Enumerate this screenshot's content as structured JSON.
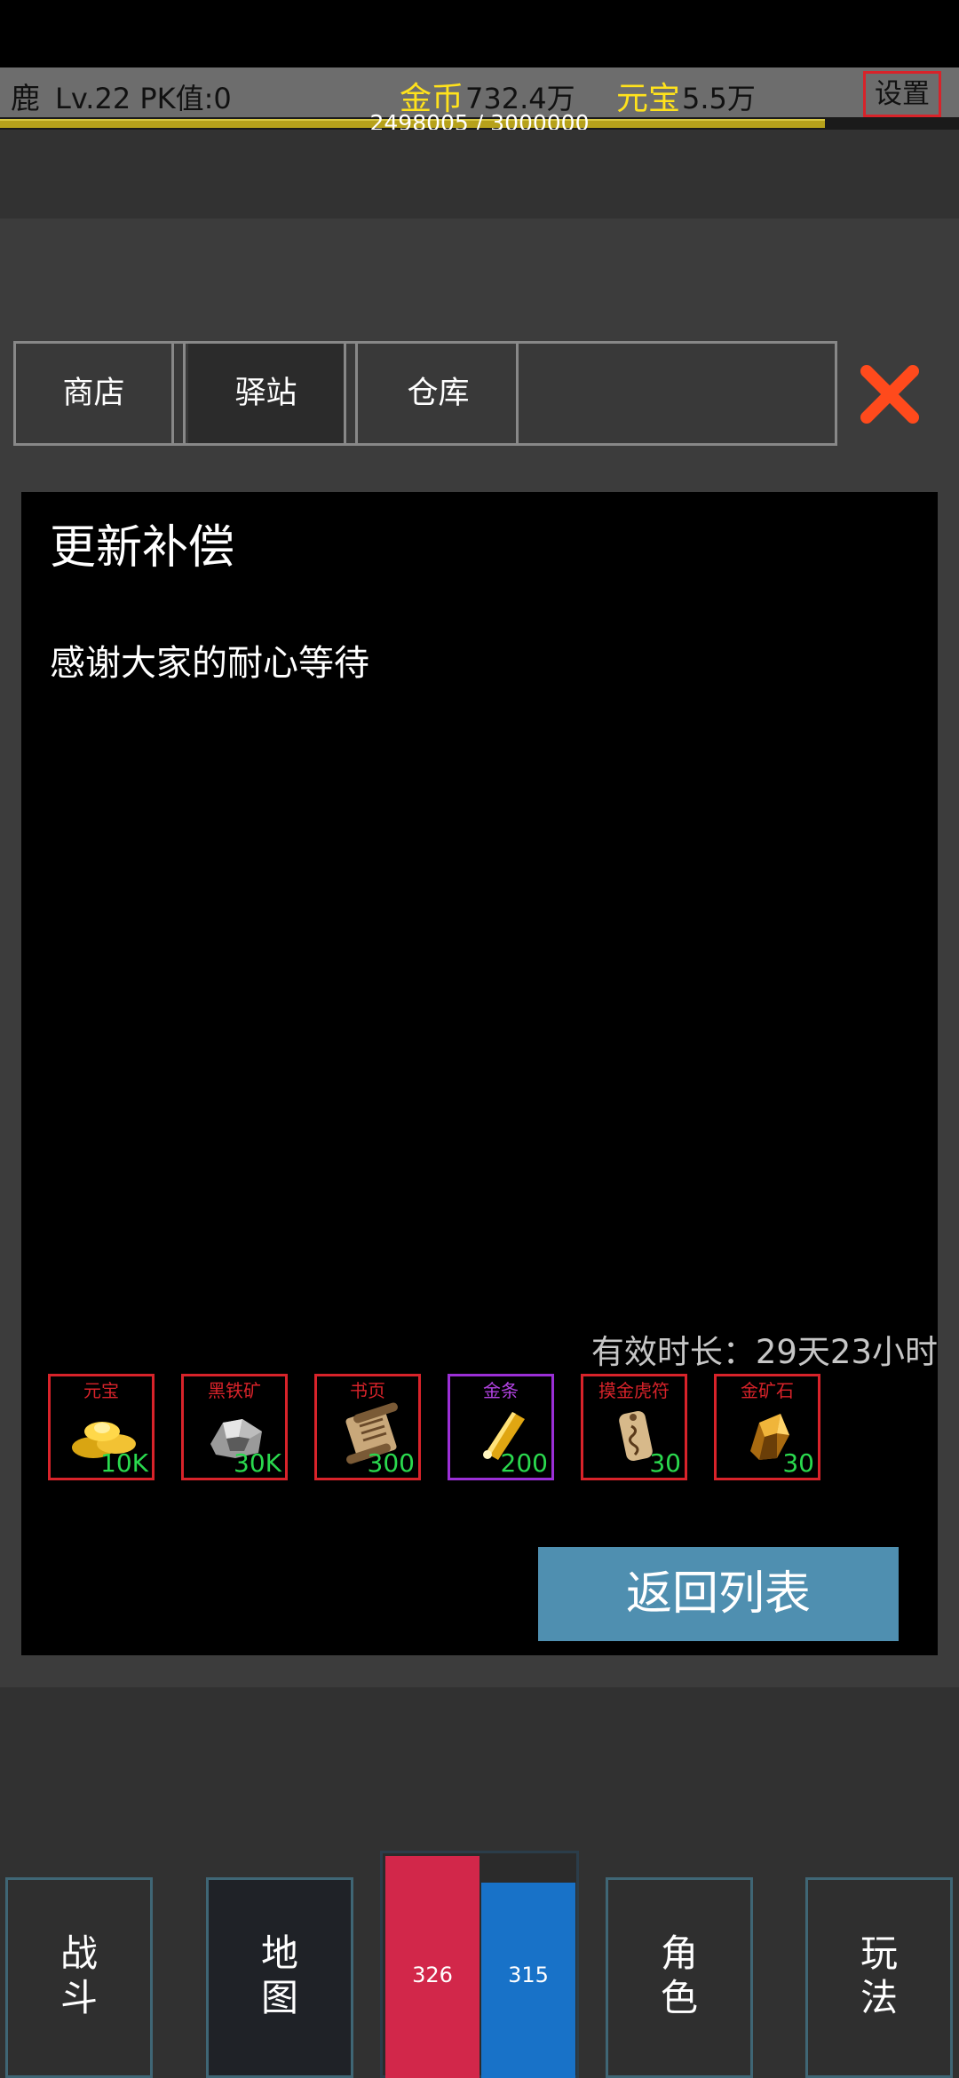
{
  "player": {
    "name": "鹿",
    "level_text": "Lv.22 PK值:0",
    "gold_label": "金币",
    "gold_value": "732.4万",
    "yuanbao_label": "元宝",
    "yuanbao_value": "5.5万",
    "settings_label": "设置",
    "exp_text": "2498005 / 3000000",
    "exp_fraction": 0.8327
  },
  "tabs": [
    {
      "label": "商店",
      "active": false
    },
    {
      "label": "驿站",
      "active": true
    },
    {
      "label": "仓库",
      "active": false
    }
  ],
  "mail": {
    "title": "更新补偿",
    "body": "感谢大家的耐心等待",
    "expiry": "有效时长：29天23小时",
    "items": [
      {
        "name": "元宝",
        "count": "10K",
        "icon": "gold-ingot-icon",
        "rarity": "red"
      },
      {
        "name": "黑铁矿",
        "count": "30K",
        "icon": "iron-ore-icon",
        "rarity": "red"
      },
      {
        "name": "书页",
        "count": "300",
        "icon": "scroll-page-icon",
        "rarity": "red"
      },
      {
        "name": "金条",
        "count": "200",
        "icon": "gold-bar-icon",
        "rarity": "purple"
      },
      {
        "name": "摸金虎符",
        "count": "30",
        "icon": "tiger-tally-icon",
        "rarity": "red"
      },
      {
        "name": "金矿石",
        "count": "30",
        "icon": "gold-ore-icon",
        "rarity": "red"
      }
    ],
    "return_label": "返回列表"
  },
  "nav": {
    "battle": "战\n斗",
    "map": "地\n图",
    "role": "角\n色",
    "play": "玩\n法",
    "hp": "326",
    "mp": "315"
  },
  "colors": {
    "gold_text": "#ffe21c",
    "hp": "#d2274a",
    "mp": "#1872c8",
    "button_blue": "#4f8fb0",
    "close_x": "#ff4a1c",
    "count_green": "#2ad94e"
  }
}
